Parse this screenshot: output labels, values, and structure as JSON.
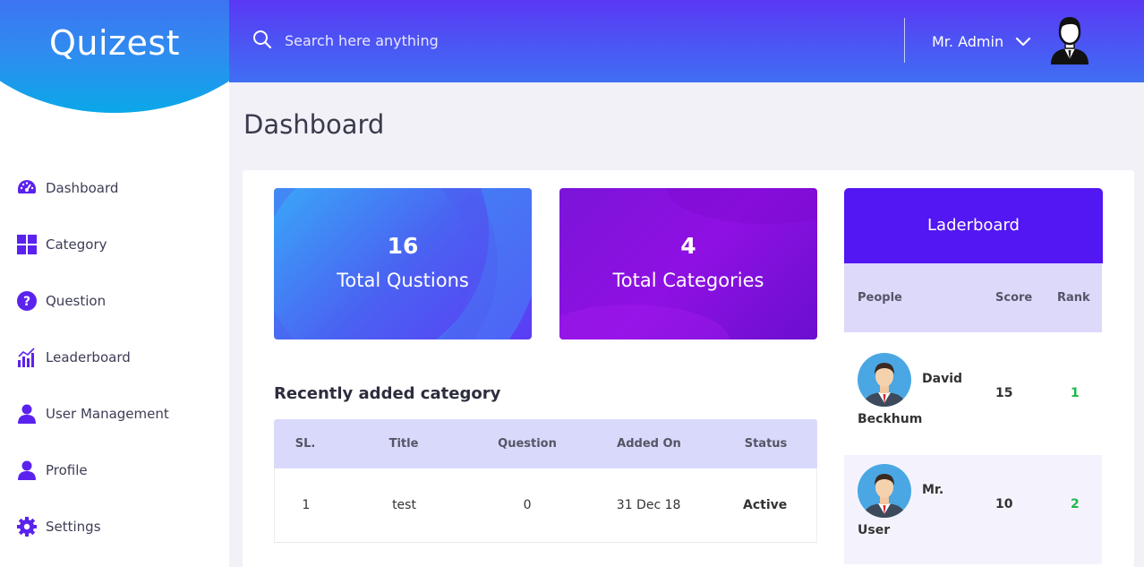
{
  "brand": {
    "logo": "Quizest"
  },
  "sidebar": {
    "items": [
      {
        "label": "Dashboard",
        "icon": "gauge-icon"
      },
      {
        "label": "Category",
        "icon": "grid-icon"
      },
      {
        "label": "Question",
        "icon": "question-icon"
      },
      {
        "label": "Leaderboard",
        "icon": "bar-chart-icon"
      },
      {
        "label": "User Management",
        "icon": "user-icon"
      },
      {
        "label": "Profile",
        "icon": "user-icon"
      },
      {
        "label": "Settings",
        "icon": "gear-icon"
      }
    ]
  },
  "header": {
    "search_placeholder": "Search here anything",
    "user_name": "Mr. Admin"
  },
  "main": {
    "title": "Dashboard",
    "stats": [
      {
        "value": "16",
        "label": "Total Qustions"
      },
      {
        "value": "4",
        "label": "Total Categories"
      }
    ],
    "recent": {
      "title": "Recently added category",
      "columns": [
        "SL.",
        "Title",
        "Question",
        "Added On",
        "Status"
      ],
      "rows": [
        {
          "sl": "1",
          "title": "test",
          "question": "0",
          "added_on": "31 Dec 18",
          "status": "Active"
        }
      ]
    }
  },
  "leaderboard": {
    "title": "Laderboard",
    "columns": [
      "People",
      "Score",
      "Rank"
    ],
    "rows": [
      {
        "first": "David",
        "last": "Beckhum",
        "score": "15",
        "rank": "1"
      },
      {
        "first": "Mr.",
        "last": "User",
        "score": "10",
        "rank": "2"
      }
    ]
  },
  "colors": {
    "accent": "#5217f2",
    "sidebar_icon": "#5b22ee",
    "status_active": "#1fb84b"
  }
}
